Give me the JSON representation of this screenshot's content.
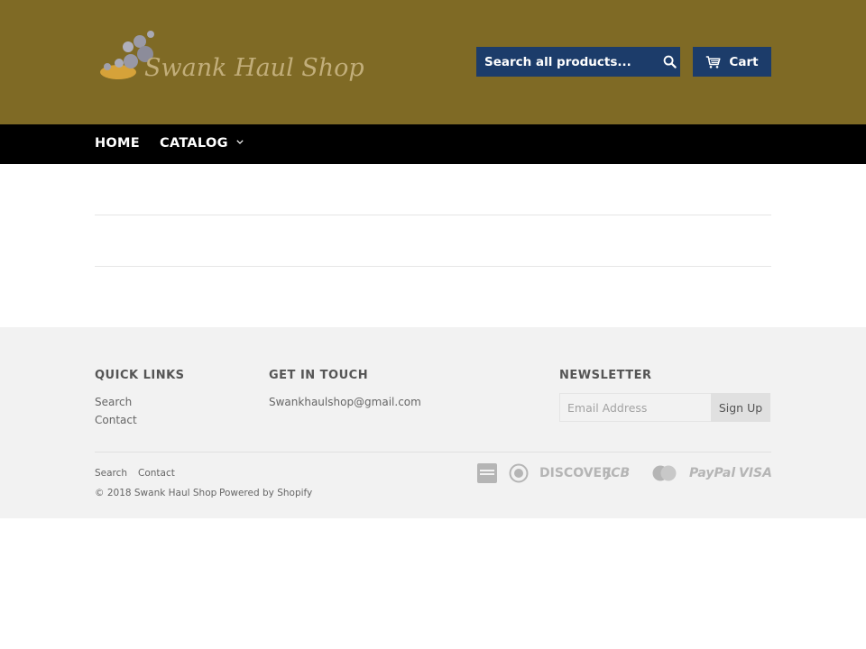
{
  "header": {
    "logo_text": "Swank Haul Shop",
    "search": {
      "placeholder": "Search all products...",
      "icon": "search-icon"
    },
    "cart": {
      "label": "Cart",
      "icon": "cart-icon"
    }
  },
  "nav": {
    "items": [
      {
        "label": "HOME"
      },
      {
        "label": "CATALOG",
        "icon": "chevron-down-icon"
      }
    ]
  },
  "footer": {
    "quick_links": {
      "heading": "QUICK LINKS",
      "links": [
        "Search",
        "Contact"
      ]
    },
    "get_in_touch": {
      "heading": "GET IN TOUCH",
      "email": "Swankhaulshop@gmail.com"
    },
    "newsletter": {
      "heading": "NEWSLETTER",
      "placeholder": "Email Address",
      "button": "Sign Up"
    },
    "bottom_links": [
      "Search",
      "Contact"
    ],
    "copyright": "© 2018 Swank Haul Shop",
    "powered_by": "Powered by Shopify",
    "payment_icons": [
      "american-express-icon",
      "diners-club-icon",
      "discover-icon",
      "jcb-icon",
      "master-icon",
      "paypal-icon",
      "visa-icon"
    ],
    "payment_labels": {
      "discover": "DISCOVER",
      "jcb": "JCB",
      "paypal": "PayPal",
      "visa": "VISA"
    }
  },
  "colors": {
    "header_bg": "#7f6a25",
    "button_bg": "#1c3c6a",
    "nav_bg": "#000000",
    "footer_bg": "#f2f2f2"
  }
}
